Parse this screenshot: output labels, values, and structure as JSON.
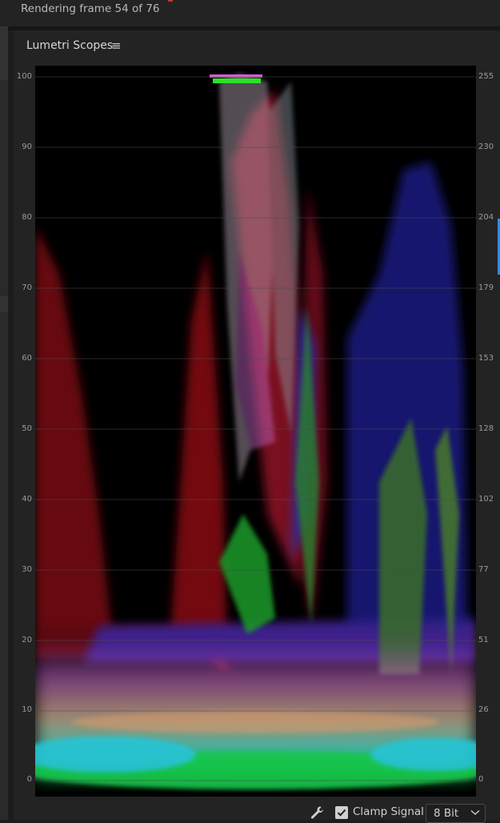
{
  "status": {
    "rendering_text": "Rendering frame 54 of 76"
  },
  "panel": {
    "title": "Lumetri Scopes",
    "menu_glyph": "≡"
  },
  "scope": {
    "type": "RGB parade / waveform",
    "left_scale": [
      "100",
      "90",
      "80",
      "70",
      "60",
      "50",
      "40",
      "30",
      "20",
      "10",
      "0"
    ],
    "right_scale": [
      "255",
      "230",
      "204",
      "179",
      "153",
      "128",
      "102",
      "77",
      "51",
      "26",
      "0"
    ]
  },
  "footer": {
    "settings_icon": "wrench-icon",
    "clamp_label": "Clamp Signal",
    "clamp_checked": true,
    "bit_depth": "8 Bit"
  },
  "colors": {
    "accent": "#2d8ceb",
    "panel_bg": "#232323",
    "scope_bg": "#000000"
  }
}
